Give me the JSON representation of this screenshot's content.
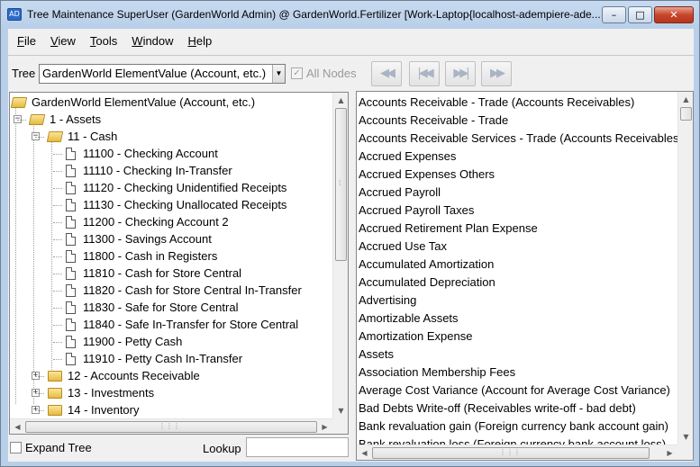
{
  "window": {
    "title": "Tree Maintenance  SuperUser (GardenWorld Admin) @ GardenWorld.Fertilizer [Work-Laptop{localhost-adempiere-ade...",
    "app_icon": "AD",
    "minimize_label": "–",
    "maximize_label": "□",
    "close_label": "✕"
  },
  "menu": {
    "items": [
      {
        "first": "F",
        "rest": "ile"
      },
      {
        "first": "V",
        "rest": "iew"
      },
      {
        "first": "T",
        "rest": "ools"
      },
      {
        "first": "W",
        "rest": "indow"
      },
      {
        "first": "H",
        "rest": "elp"
      }
    ]
  },
  "toolbar": {
    "tree_label": "Tree",
    "tree_value": "GardenWorld ElementValue (Account, etc.)",
    "all_nodes_label": "All Nodes",
    "all_nodes_checked": true,
    "nav_icons": [
      "first-icon",
      "previous-icon",
      "next-icon",
      "last-icon"
    ],
    "nav_glyphs": [
      "◀◀",
      "|◀◀",
      "▶▶|",
      "▶▶"
    ]
  },
  "tree": {
    "root": "GardenWorld ElementValue (Account, etc.)",
    "nodes": [
      "1 - Assets",
      "11 - Cash",
      "11100 - Checking Account",
      "11110 - Checking In-Transfer",
      "11120 - Checking Unidentified Receipts",
      "11130 - Checking Unallocated Receipts",
      "11200 - Checking Account 2",
      "11300 - Savings Account",
      "11800 - Cash in Registers",
      "11810 - Cash for Store Central",
      "11820 - Cash for Store Central In-Transfer",
      "11830 - Safe for Store Central",
      "11840 - Safe In-Transfer for Store Central",
      "11900 - Petty Cash",
      "11910 - Petty Cash In-Transfer",
      "12 - Accounts Receivable",
      "13 - Investments",
      "14 - Inventory"
    ]
  },
  "bottom": {
    "expand_tree_label": "Expand Tree",
    "lookup_label": "Lookup",
    "lookup_value": ""
  },
  "list": {
    "items": [
      "Accounts Receivable - Trade (Accounts Receivables)",
      "Accounts Receivable - Trade",
      "Accounts Receivable Services - Trade (Accounts Receivables",
      "Accrued Expenses",
      "Accrued Expenses Others",
      "Accrued Payroll",
      "Accrued Payroll Taxes",
      "Accrued Retirement Plan Expense",
      "Accrued Use Tax",
      "Accumulated Amortization",
      "Accumulated Depreciation",
      "Advertising",
      "Amortizable Assets",
      "Amortization Expense",
      "Assets",
      "Association Membership Fees",
      "Average Cost Variance (Account for Average Cost Variance)",
      "Bad Debts Write-off (Receivables write-off - bad debt)",
      "Bank revaluation gain (Foreign currency bank account gain)",
      "Bank revaluation loss (Foreign currency bank account loss)"
    ]
  }
}
